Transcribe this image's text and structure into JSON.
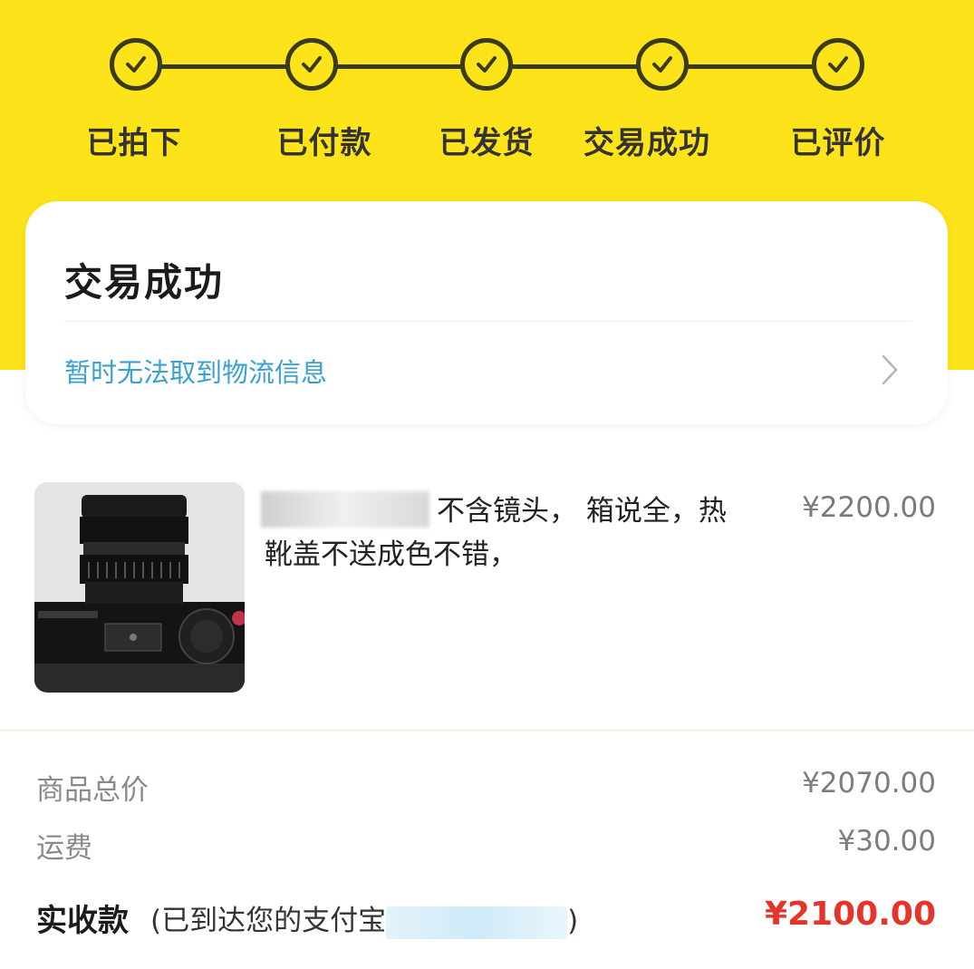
{
  "progress": {
    "steps": [
      {
        "label": "已拍下",
        "done": true
      },
      {
        "label": "已付款",
        "done": true
      },
      {
        "label": "已发货",
        "done": true
      },
      {
        "label": "交易成功",
        "done": true
      },
      {
        "label": "已评价",
        "done": true
      }
    ]
  },
  "status": {
    "title": "交易成功",
    "logistics_text": "暂时无法取到物流信息"
  },
  "product": {
    "title": "不含镜头， 箱说全，热靴盖不送成色不错，",
    "price": "¥2200.00",
    "thumb_icon": "camera-photo"
  },
  "summary": {
    "goods_total_label": "商品总价",
    "goods_total_value": "¥2070.00",
    "shipping_label": "运费",
    "shipping_value": "¥30.00",
    "received_label": "实收款",
    "received_note_prefix": "(已到达您的支付宝",
    "received_note_suffix": ")",
    "received_value": "¥2100.00"
  },
  "colors": {
    "header_yellow": "#fde319",
    "link_blue": "#3aa1d2",
    "price_red": "#e5352a"
  }
}
